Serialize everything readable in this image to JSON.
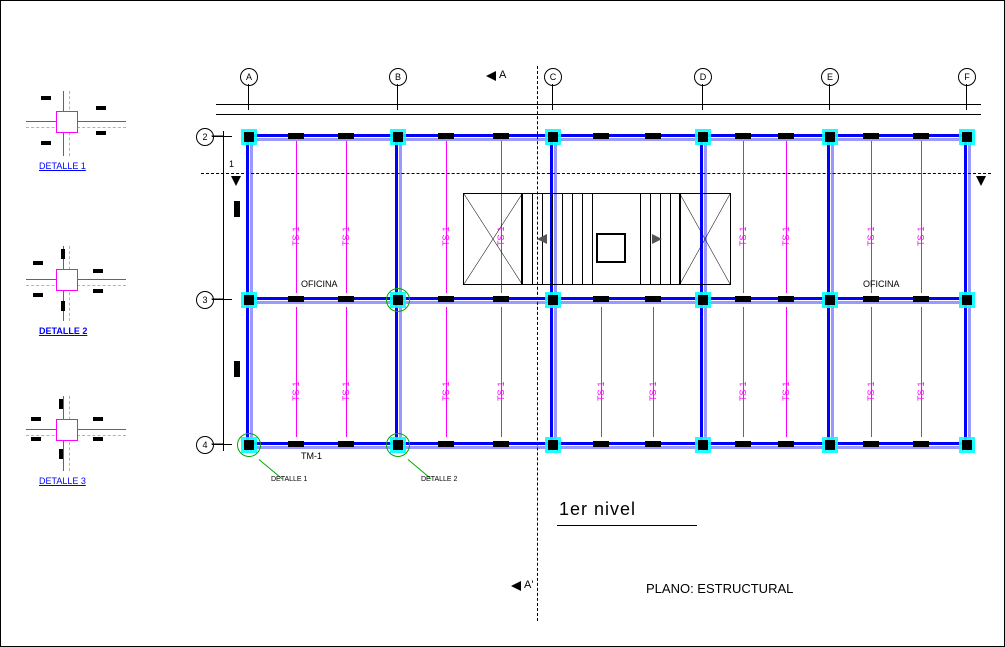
{
  "title": "1er nivel",
  "plan_label": "PLANO: ESTRUCTURAL",
  "section_marker_top": "A",
  "section_marker_bottom": "A'",
  "grid_cols": [
    "A",
    "B",
    "C",
    "D",
    "E",
    "F"
  ],
  "grid_rows": [
    "2",
    "3",
    "4"
  ],
  "room_label_1": "OFICINA",
  "room_label_2": "OFICINA",
  "joist_label": "TS-1",
  "beam_label": "TM-1",
  "detail_callout_1": "DETALLE 1",
  "detail_callout_2": "DETALLE 2",
  "details": {
    "d1": "DETALLE 1",
    "d2": "DETALLE 2",
    "d3": "DETALLE 3"
  },
  "section_cut_label": "1"
}
